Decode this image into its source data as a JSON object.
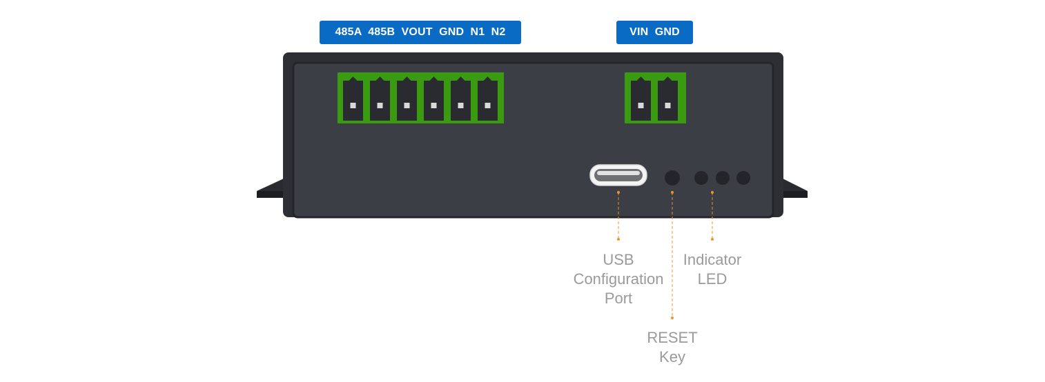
{
  "terminal_labels": {
    "left": "485A  485B  VOUT  GND  N1  N2",
    "right": "VIN  GND"
  },
  "callouts": {
    "usb": "USB\nConfiguration\nPort",
    "led": "Indicator\nLED",
    "reset": "RESET\nKey"
  },
  "colors": {
    "label_bg": "#0a6bc4",
    "device_body": "#3c3e46",
    "terminal_green": "#3a9a10",
    "callout_line": "#f0932b",
    "callout_text": "#9a9a9a"
  }
}
